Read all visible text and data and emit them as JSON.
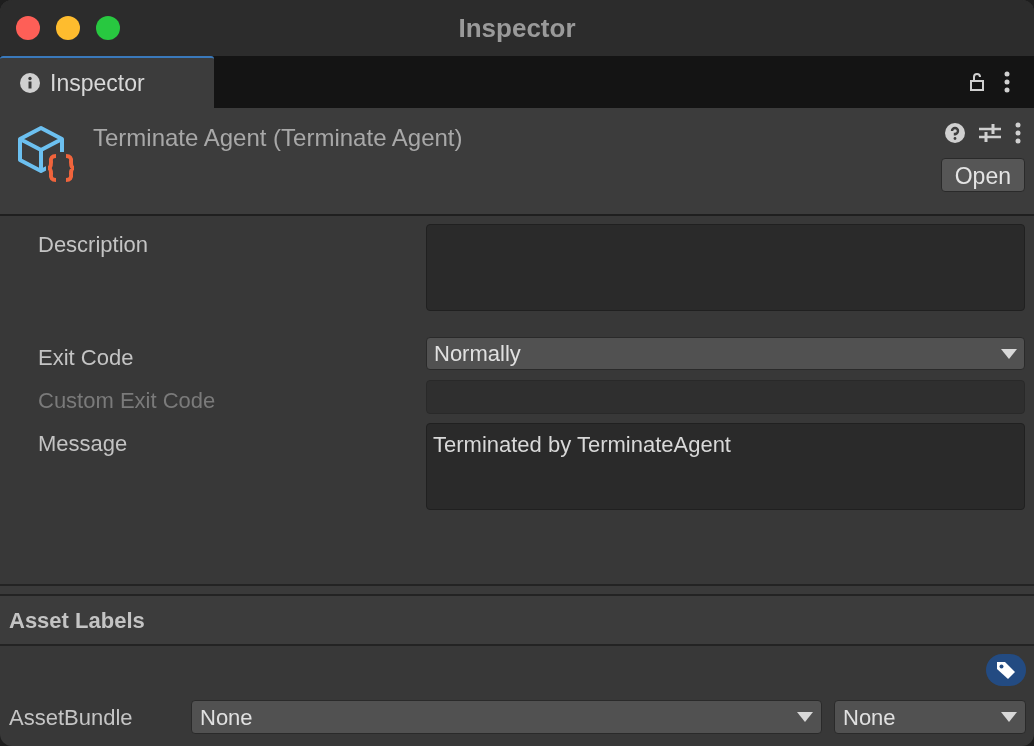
{
  "window": {
    "title": "Inspector"
  },
  "tabs": [
    {
      "label": "Inspector",
      "selected": true
    }
  ],
  "header": {
    "title": "Terminate Agent (Terminate Agent)",
    "open_button": "Open"
  },
  "fields": [
    {
      "kind": "textarea",
      "label": "Description",
      "disabled": false
    },
    {
      "kind": "dropdown",
      "label": "Exit Code",
      "value": "Normally",
      "disabled": false
    },
    {
      "kind": "text",
      "label": "Custom Exit Code",
      "disabled": true
    },
    {
      "kind": "textarea",
      "label": "Message",
      "value": "Terminated by TerminateAgent",
      "disabled": false
    }
  ],
  "asset_labels": {
    "title": "Asset Labels",
    "bundle_label": "AssetBundle",
    "bundle_name": "None",
    "bundle_variant": "None"
  }
}
